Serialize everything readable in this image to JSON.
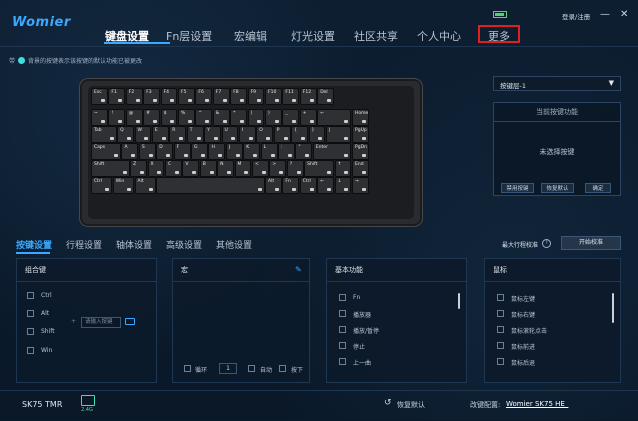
{
  "brand": {
    "logo": "Womier"
  },
  "nav": {
    "items": [
      "键盘设置",
      "Fn层设置",
      "宏编辑",
      "灯光设置",
      "社区共享",
      "个人中心",
      "更多"
    ],
    "active": "键盘设置"
  },
  "top_right": {
    "login": "登录/注册",
    "battery_icon": "battery-icon",
    "minimize": "—",
    "close": "✕"
  },
  "hint": {
    "text": "背景的按键表示该按键的默认功能已被更改",
    "prefix": "带"
  },
  "keyboard": {
    "rows": [
      [
        "Esc",
        "F1",
        "F2",
        "F3",
        "F4",
        "F5",
        "F6",
        "F7",
        "F8",
        "F9",
        "F10",
        "F11",
        "F12",
        "Del"
      ],
      [
        "~",
        "!",
        "@",
        "#",
        "$",
        "%",
        "^",
        "&",
        "*",
        "(",
        ")",
        "_",
        "+",
        "←",
        "Home"
      ],
      [
        "Tab",
        "Q",
        "W",
        "E",
        "R",
        "T",
        "Y",
        "U",
        "I",
        "O",
        "P",
        "{",
        "}",
        "|",
        "PgUp"
      ],
      [
        "Caps",
        "A",
        "S",
        "D",
        "F",
        "G",
        "H",
        "J",
        "K",
        "L",
        ":",
        "\"",
        "Enter",
        "PgDn"
      ],
      [
        "Shift",
        "Z",
        "X",
        "C",
        "V",
        "B",
        "N",
        "M",
        "<",
        ">",
        "?",
        "Shift",
        "↑",
        "End"
      ],
      [
        "Ctrl",
        "Win",
        "Alt",
        "",
        "Alt",
        "Fn",
        "Ctrl",
        "←",
        "↓",
        "→"
      ]
    ]
  },
  "right_panel": {
    "layer_select": "按键层-1",
    "current_title": "当前按键功能",
    "current_value": "未选择按键",
    "buttons": [
      "禁用按键",
      "恢复默认",
      "确定"
    ]
  },
  "tabs": {
    "items": [
      "按键设置",
      "行程设置",
      "轴体设置",
      "高级设置",
      "其他设置"
    ],
    "active": "按键设置"
  },
  "calibration": {
    "label": "最大行程校准",
    "button": "开始校准"
  },
  "combo": {
    "title": "组合键",
    "keys": [
      "Ctrl",
      "Alt",
      "Shift",
      "Win"
    ],
    "input_placeholder": "请输入按键"
  },
  "macro": {
    "title": "宏",
    "loop_label": "循环",
    "loop_value": "1",
    "auto_label": "自动",
    "release_label": "按下"
  },
  "basic": {
    "title": "基本功能",
    "items": [
      "Fn",
      "播放器",
      "播放/暂停",
      "停止",
      "上一曲"
    ]
  },
  "mouse": {
    "title": "鼠标",
    "items": [
      "鼠标左键",
      "鼠标右键",
      "鼠标滚轮点击",
      "鼠标前进",
      "鼠标后退"
    ]
  },
  "footer": {
    "model": "SK75 TMR",
    "device_label": "2.4G",
    "restore": "恢复默认",
    "config_label": "改键配置:",
    "config_value": "Womier SK75 HE_"
  },
  "colors": {
    "accent": "#3aa8ff",
    "highlight_box": "#e02020",
    "background": "#0b1a2b"
  }
}
